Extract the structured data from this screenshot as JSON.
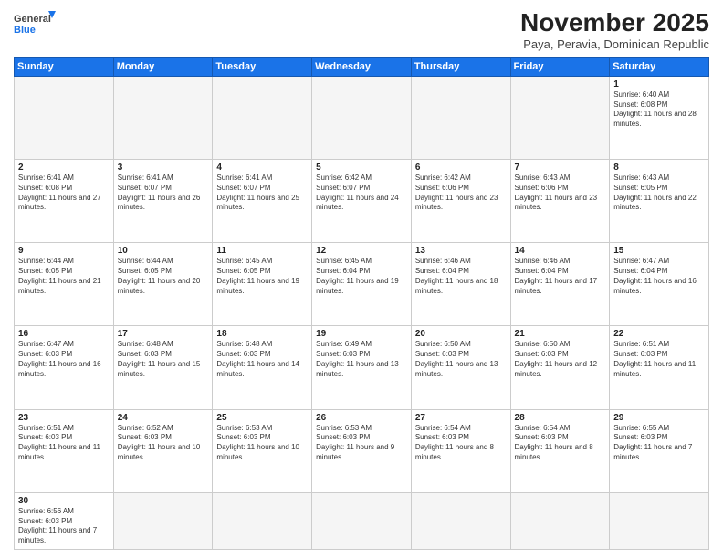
{
  "header": {
    "logo_line1": "General",
    "logo_line2": "Blue",
    "month": "November 2025",
    "location": "Paya, Peravia, Dominican Republic"
  },
  "weekdays": [
    "Sunday",
    "Monday",
    "Tuesday",
    "Wednesday",
    "Thursday",
    "Friday",
    "Saturday"
  ],
  "days": {
    "1": {
      "sunrise": "6:40 AM",
      "sunset": "6:08 PM",
      "daylight": "11 hours and 28 minutes."
    },
    "2": {
      "sunrise": "6:41 AM",
      "sunset": "6:08 PM",
      "daylight": "11 hours and 27 minutes."
    },
    "3": {
      "sunrise": "6:41 AM",
      "sunset": "6:07 PM",
      "daylight": "11 hours and 26 minutes."
    },
    "4": {
      "sunrise": "6:41 AM",
      "sunset": "6:07 PM",
      "daylight": "11 hours and 25 minutes."
    },
    "5": {
      "sunrise": "6:42 AM",
      "sunset": "6:07 PM",
      "daylight": "11 hours and 24 minutes."
    },
    "6": {
      "sunrise": "6:42 AM",
      "sunset": "6:06 PM",
      "daylight": "11 hours and 23 minutes."
    },
    "7": {
      "sunrise": "6:43 AM",
      "sunset": "6:06 PM",
      "daylight": "11 hours and 23 minutes."
    },
    "8": {
      "sunrise": "6:43 AM",
      "sunset": "6:05 PM",
      "daylight": "11 hours and 22 minutes."
    },
    "9": {
      "sunrise": "6:44 AM",
      "sunset": "6:05 PM",
      "daylight": "11 hours and 21 minutes."
    },
    "10": {
      "sunrise": "6:44 AM",
      "sunset": "6:05 PM",
      "daylight": "11 hours and 20 minutes."
    },
    "11": {
      "sunrise": "6:45 AM",
      "sunset": "6:05 PM",
      "daylight": "11 hours and 19 minutes."
    },
    "12": {
      "sunrise": "6:45 AM",
      "sunset": "6:04 PM",
      "daylight": "11 hours and 19 minutes."
    },
    "13": {
      "sunrise": "6:46 AM",
      "sunset": "6:04 PM",
      "daylight": "11 hours and 18 minutes."
    },
    "14": {
      "sunrise": "6:46 AM",
      "sunset": "6:04 PM",
      "daylight": "11 hours and 17 minutes."
    },
    "15": {
      "sunrise": "6:47 AM",
      "sunset": "6:04 PM",
      "daylight": "11 hours and 16 minutes."
    },
    "16": {
      "sunrise": "6:47 AM",
      "sunset": "6:03 PM",
      "daylight": "11 hours and 16 minutes."
    },
    "17": {
      "sunrise": "6:48 AM",
      "sunset": "6:03 PM",
      "daylight": "11 hours and 15 minutes."
    },
    "18": {
      "sunrise": "6:48 AM",
      "sunset": "6:03 PM",
      "daylight": "11 hours and 14 minutes."
    },
    "19": {
      "sunrise": "6:49 AM",
      "sunset": "6:03 PM",
      "daylight": "11 hours and 13 minutes."
    },
    "20": {
      "sunrise": "6:50 AM",
      "sunset": "6:03 PM",
      "daylight": "11 hours and 13 minutes."
    },
    "21": {
      "sunrise": "6:50 AM",
      "sunset": "6:03 PM",
      "daylight": "11 hours and 12 minutes."
    },
    "22": {
      "sunrise": "6:51 AM",
      "sunset": "6:03 PM",
      "daylight": "11 hours and 11 minutes."
    },
    "23": {
      "sunrise": "6:51 AM",
      "sunset": "6:03 PM",
      "daylight": "11 hours and 11 minutes."
    },
    "24": {
      "sunrise": "6:52 AM",
      "sunset": "6:03 PM",
      "daylight": "11 hours and 10 minutes."
    },
    "25": {
      "sunrise": "6:53 AM",
      "sunset": "6:03 PM",
      "daylight": "11 hours and 10 minutes."
    },
    "26": {
      "sunrise": "6:53 AM",
      "sunset": "6:03 PM",
      "daylight": "11 hours and 9 minutes."
    },
    "27": {
      "sunrise": "6:54 AM",
      "sunset": "6:03 PM",
      "daylight": "11 hours and 8 minutes."
    },
    "28": {
      "sunrise": "6:54 AM",
      "sunset": "6:03 PM",
      "daylight": "11 hours and 8 minutes."
    },
    "29": {
      "sunrise": "6:55 AM",
      "sunset": "6:03 PM",
      "daylight": "11 hours and 7 minutes."
    },
    "30": {
      "sunrise": "6:56 AM",
      "sunset": "6:03 PM",
      "daylight": "11 hours and 7 minutes."
    }
  }
}
